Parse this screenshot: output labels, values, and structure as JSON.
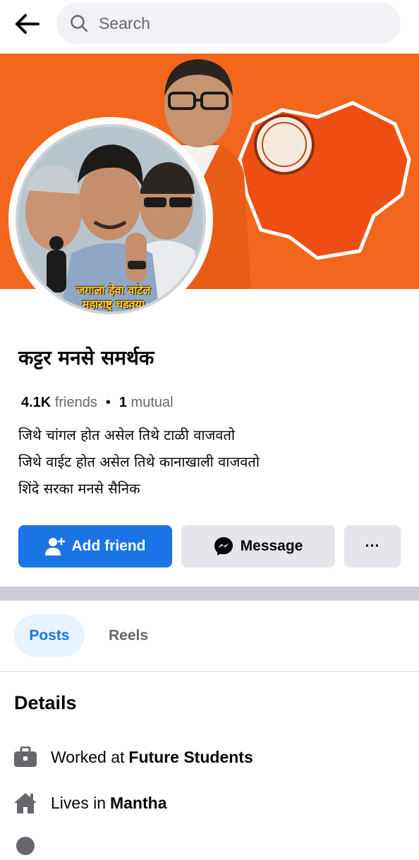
{
  "search": {
    "placeholder": "Search"
  },
  "profile": {
    "name": "कट्टर मनसे समर्थक",
    "friends_count": "4.1K",
    "friends_label": "friends",
    "mutual_count": "1",
    "mutual_label": "mutual",
    "bio": [
      "जिथे चांगल होत असेल तिथे टाळी वाजवतो",
      "जिथे वाईट होत असेल तिथे कानाखाली वाजवतो",
      " शिंदे सरका मनसे सैनिक"
    ],
    "avatar_caption_line1": "जगाला हेवा वाटेल",
    "avatar_caption_line2": "महाराष्ट्र घडवूया"
  },
  "actions": {
    "add_friend": "Add friend",
    "message": "Message",
    "more": "···"
  },
  "tabs": [
    {
      "label": "Posts",
      "active": true
    },
    {
      "label": "Reels",
      "active": false
    }
  ],
  "details": {
    "title": "Details",
    "items": [
      {
        "icon": "briefcase-icon",
        "prefix": "Worked at",
        "value": "Future Students"
      },
      {
        "icon": "home-icon",
        "prefix": "Lives in",
        "value": "Mantha"
      }
    ]
  },
  "colors": {
    "accent": "#1b74e4",
    "cover": "#f2661e",
    "secondary_text": "#65676b",
    "button_gray": "#e4e6eb"
  }
}
